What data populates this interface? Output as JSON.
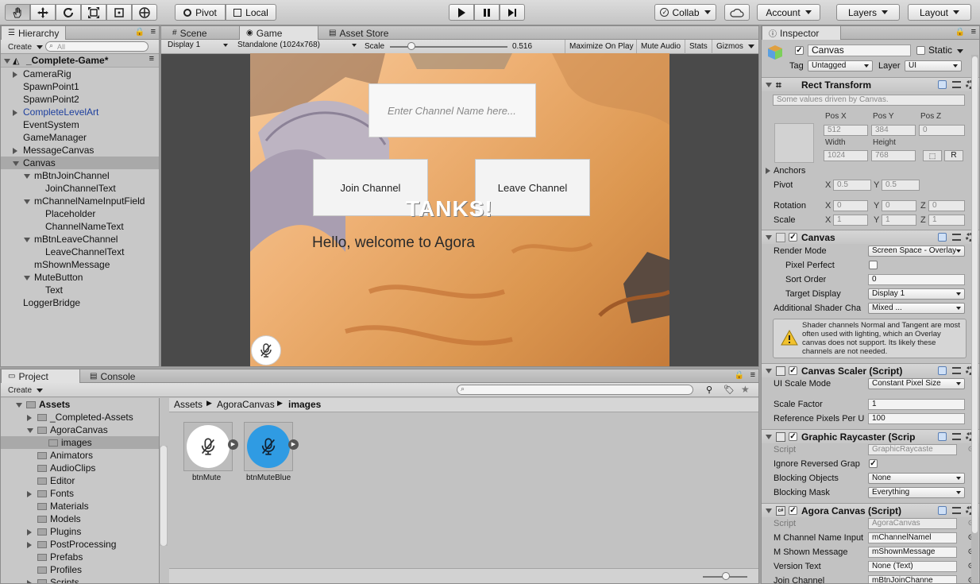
{
  "toolbar": {
    "tools": [
      "hand-tool",
      "move-tool",
      "rotate-tool",
      "scale-tool",
      "rect-tool",
      "transform-tool"
    ],
    "pivot_label": "Pivot",
    "local_label": "Local",
    "collab_label": "Collab",
    "account_label": "Account",
    "layers_label": "Layers",
    "layout_label": "Layout"
  },
  "hierarchy": {
    "tab": "Hierarchy",
    "create_label": "Create",
    "search_placeholder": "All",
    "scene_name": "_Complete-Game*",
    "items": [
      {
        "label": "CameraRig",
        "indent": 0,
        "arrow": "right"
      },
      {
        "label": "SpawnPoint1",
        "indent": 0,
        "arrow": ""
      },
      {
        "label": "SpawnPoint2",
        "indent": 0,
        "arrow": ""
      },
      {
        "label": "CompleteLevelArt",
        "indent": 0,
        "arrow": "right",
        "prefab": true
      },
      {
        "label": "EventSystem",
        "indent": 0,
        "arrow": ""
      },
      {
        "label": "GameManager",
        "indent": 0,
        "arrow": ""
      },
      {
        "label": "MessageCanvas",
        "indent": 0,
        "arrow": "right"
      },
      {
        "label": "Canvas",
        "indent": 0,
        "arrow": "down",
        "selected": true
      },
      {
        "label": "mBtnJoinChannel",
        "indent": 1,
        "arrow": "down"
      },
      {
        "label": "JoinChannelText",
        "indent": 2,
        "arrow": ""
      },
      {
        "label": "mChannelNameInputField",
        "indent": 1,
        "arrow": "down"
      },
      {
        "label": "Placeholder",
        "indent": 2,
        "arrow": ""
      },
      {
        "label": "ChannelNameText",
        "indent": 2,
        "arrow": ""
      },
      {
        "label": "mBtnLeaveChannel",
        "indent": 1,
        "arrow": "down"
      },
      {
        "label": "LeaveChannelText",
        "indent": 2,
        "arrow": ""
      },
      {
        "label": "mShownMessage",
        "indent": 1,
        "arrow": ""
      },
      {
        "label": "MuteButton",
        "indent": 1,
        "arrow": "down"
      },
      {
        "label": "Text",
        "indent": 2,
        "arrow": ""
      },
      {
        "label": "LoggerBridge",
        "indent": 0,
        "arrow": ""
      }
    ]
  },
  "center_tabs": {
    "scene": "Scene",
    "game": "Game",
    "asset_store": "Asset Store"
  },
  "game_bar": {
    "display": "Display 1",
    "resolution": "Standalone (1024x768)",
    "scale_label": "Scale",
    "scale_value": "0.516",
    "scale_fraction": 0.18,
    "maximize": "Maximize On Play",
    "mute": "Mute Audio",
    "stats": "Stats",
    "gizmos": "Gizmos"
  },
  "game_view": {
    "input_placeholder": "Enter Channel Name here...",
    "join_button": "Join Channel",
    "leave_button": "Leave Channel",
    "logo": "TANKS!",
    "message": "Hello, welcome to Agora"
  },
  "project": {
    "tab_project": "Project",
    "tab_console": "Console",
    "create_label": "Create",
    "tree": [
      {
        "label": "Assets",
        "indent": 0,
        "arrow": "down",
        "bold": true
      },
      {
        "label": "_Completed-Assets",
        "indent": 1,
        "arrow": "right"
      },
      {
        "label": "AgoraCanvas",
        "indent": 1,
        "arrow": "down"
      },
      {
        "label": "images",
        "indent": 2,
        "arrow": "",
        "selected": true
      },
      {
        "label": "Animators",
        "indent": 1,
        "arrow": ""
      },
      {
        "label": "AudioClips",
        "indent": 1,
        "arrow": ""
      },
      {
        "label": "Editor",
        "indent": 1,
        "arrow": ""
      },
      {
        "label": "Fonts",
        "indent": 1,
        "arrow": "right"
      },
      {
        "label": "Materials",
        "indent": 1,
        "arrow": ""
      },
      {
        "label": "Models",
        "indent": 1,
        "arrow": ""
      },
      {
        "label": "Plugins",
        "indent": 1,
        "arrow": "right"
      },
      {
        "label": "PostProcessing",
        "indent": 1,
        "arrow": "right"
      },
      {
        "label": "Prefabs",
        "indent": 1,
        "arrow": ""
      },
      {
        "label": "Profiles",
        "indent": 1,
        "arrow": ""
      },
      {
        "label": "Scripts",
        "indent": 1,
        "arrow": "right"
      }
    ],
    "breadcrumb": [
      "Assets",
      "AgoraCanvas",
      "images"
    ],
    "assets": [
      {
        "label": "btnMute",
        "color": "#ffffff"
      },
      {
        "label": "btnMuteBlue",
        "color": "#2f9be3"
      }
    ]
  },
  "inspector": {
    "tab": "Inspector",
    "object_name": "Canvas",
    "static_label": "Static",
    "tag_label": "Tag",
    "tag_value": "Untagged",
    "layer_label": "Layer",
    "layer_value": "UI",
    "rect_transform": {
      "title": "Rect Transform",
      "note": "Some values driven by Canvas.",
      "pos_x_label": "Pos X",
      "pos_y_label": "Pos Y",
      "pos_z_label": "Pos Z",
      "pos_x": "512",
      "pos_y": "384",
      "pos_z": "0",
      "width_label": "Width",
      "height_label": "Height",
      "width": "1024",
      "height": "768",
      "r_label": "R",
      "anchors": "Anchors",
      "pivot_label": "Pivot",
      "pivot_x": "0.5",
      "pivot_y": "0.5",
      "rotation_label": "Rotation",
      "rot_x": "0",
      "rot_y": "0",
      "rot_z": "0",
      "scale_label": "Scale",
      "scale_x": "1",
      "scale_y": "1",
      "scale_z": "1",
      "x": "X",
      "y": "Y",
      "z": "Z"
    },
    "canvas": {
      "title": "Canvas",
      "render_mode_label": "Render Mode",
      "render_mode": "Screen Space - Overlay",
      "pixel_perfect_label": "Pixel Perfect",
      "sort_order_label": "Sort Order",
      "sort_order": "0",
      "target_display_label": "Target Display",
      "target_display": "Display 1",
      "shader_label": "Additional Shader Cha",
      "shader_value": "Mixed ...",
      "warning": "Shader channels Normal and Tangent are most often used with lighting, which an Overlay canvas does not support. Its likely these channels are not needed."
    },
    "canvas_scaler": {
      "title": "Canvas Scaler (Script)",
      "ui_scale_label": "UI Scale Mode",
      "ui_scale": "Constant Pixel Size",
      "scale_factor_label": "Scale Factor",
      "scale_factor": "1",
      "ref_pixels_label": "Reference Pixels Per U",
      "ref_pixels": "100"
    },
    "raycaster": {
      "title": "Graphic Raycaster (Scrip",
      "script_label": "Script",
      "script": "GraphicRaycaste",
      "ignore_label": "Ignore Reversed Grap",
      "blocking_objects_label": "Blocking Objects",
      "blocking_objects": "None",
      "blocking_mask_label": "Blocking Mask",
      "blocking_mask": "Everything"
    },
    "agora": {
      "title": "Agora Canvas (Script)",
      "script_label": "Script",
      "script": "AgoraCanvas",
      "channel_input_label": "M Channel Name Input",
      "channel_input": "mChannelNamel",
      "shown_message_label": "M Shown Message",
      "shown_message": "mShownMessage",
      "version_label": "Version Text",
      "version": "None (Text)",
      "join_label": "Join Channel",
      "join": "mBtnJoinChanne"
    }
  },
  "colors": {
    "toolbar_bg": "#d0d0d0",
    "panel_bg": "#c2c2c2",
    "selection": "#a9a9a9",
    "prefab_blue": "#1d3f9e",
    "game_bg": "#e8a765",
    "accent_blue": "#2f9be3"
  }
}
